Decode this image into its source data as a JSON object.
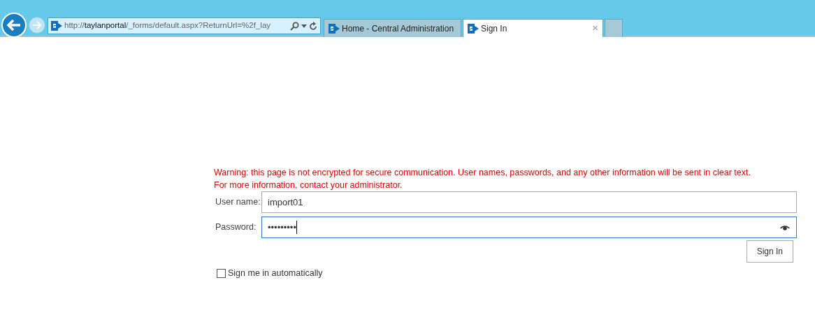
{
  "browser": {
    "address": {
      "parts": [
        {
          "text": "http://",
          "emphasized": false
        },
        {
          "text": "taylanportal",
          "emphasized": true
        },
        {
          "text": "/_forms/default.aspx?ReturnUrl=%2f_lay",
          "emphasized": false
        }
      ]
    },
    "tabs": [
      {
        "title": "Home - Central Administration",
        "selected": false
      },
      {
        "title": "Sign In",
        "selected": true,
        "close": "×"
      }
    ]
  },
  "form": {
    "warning": [
      "Warning: this page is not encrypted for secure communication. User names, passwords, and any other information will be sent in clear text.",
      "For more information, contact your administrator."
    ],
    "fields": [
      {
        "label": "User name:",
        "value": "import01",
        "focused": false
      },
      {
        "label": "Password:",
        "value": "•••••••••",
        "focused": true,
        "reveal": true
      }
    ],
    "button": "Sign In",
    "remember": {
      "label": "Sign me in automatically",
      "checked": false
    }
  }
}
